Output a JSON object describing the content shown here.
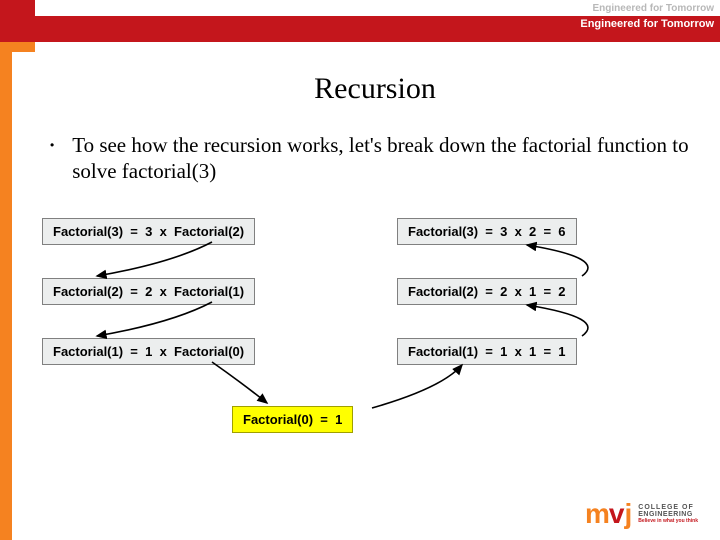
{
  "header": {
    "tagline1": "Engineered for Tomorrow",
    "tagline2": "Engineered for Tomorrow"
  },
  "title": "Recursion",
  "body": {
    "bullet": "•",
    "text": "To see how the recursion works, let's break down the factorial function to solve factorial(3)"
  },
  "boxes": {
    "l1": "Factorial(3)  =  3  x  Factorial(2)",
    "l2": "Factorial(2)  =  2  x  Factorial(1)",
    "l3": "Factorial(1)  =  1  x  Factorial(0)",
    "r1": "Factorial(3)  =  3  x  2  =  6",
    "r2": "Factorial(2)  =  2  x  1  =  2",
    "r3": "Factorial(1)  =  1  x  1  =  1",
    "base": "Factorial(0)  =  1"
  },
  "logo": {
    "m": "m",
    "v": "v",
    "j": "j",
    "l1": "COLLEGE OF",
    "l2": "ENGINEERING",
    "l3": "Believe in what you think"
  }
}
